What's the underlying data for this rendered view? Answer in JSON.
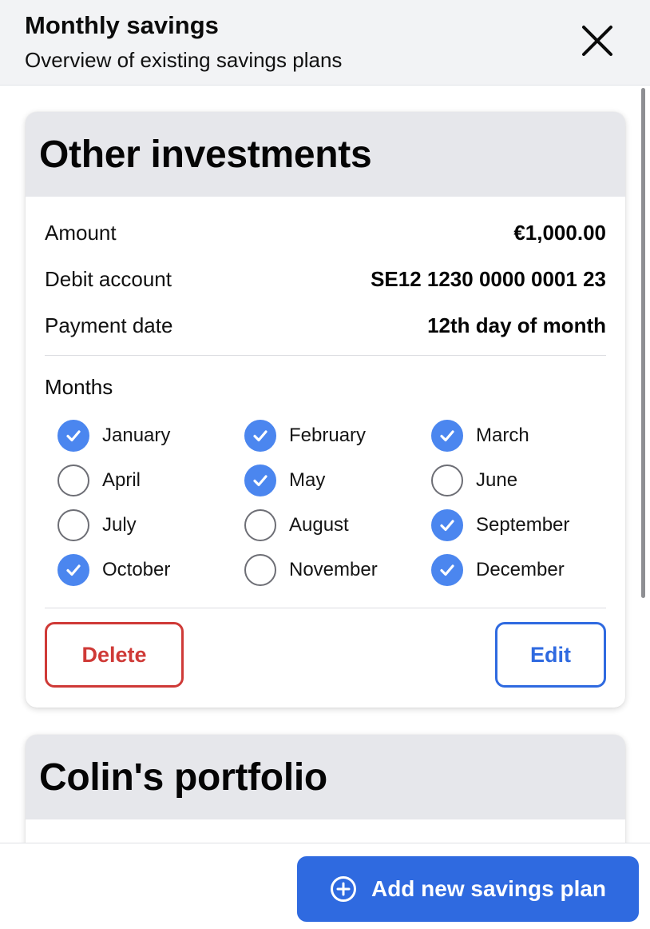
{
  "header": {
    "title": "Monthly savings",
    "subtitle": "Overview of existing savings plans",
    "close_icon": "close-icon"
  },
  "plans": [
    {
      "title": "Other investments",
      "details": [
        {
          "label": "Amount",
          "value": "€1,000.00"
        },
        {
          "label": "Debit account",
          "value": "SE12 1230 0000 0001 23"
        },
        {
          "label": "Payment date",
          "value": "12th day of month"
        }
      ],
      "months_label": "Months",
      "months": [
        {
          "name": "January",
          "checked": true
        },
        {
          "name": "February",
          "checked": true
        },
        {
          "name": "March",
          "checked": true
        },
        {
          "name": "April",
          "checked": false
        },
        {
          "name": "May",
          "checked": true
        },
        {
          "name": "June",
          "checked": false
        },
        {
          "name": "July",
          "checked": false
        },
        {
          "name": "August",
          "checked": false
        },
        {
          "name": "September",
          "checked": true
        },
        {
          "name": "October",
          "checked": true
        },
        {
          "name": "November",
          "checked": false
        },
        {
          "name": "December",
          "checked": true
        }
      ],
      "delete_label": "Delete",
      "edit_label": "Edit"
    },
    {
      "title": "Colin's portfolio"
    }
  ],
  "footer": {
    "add_label": "Add new savings plan",
    "add_icon": "plus-circle-icon"
  },
  "colors": {
    "primary": "#2f6ae0",
    "checked": "#4b86ef",
    "danger": "#cf3a37",
    "header_bg": "#f2f3f5",
    "card_header_bg": "#e6e7eb"
  }
}
